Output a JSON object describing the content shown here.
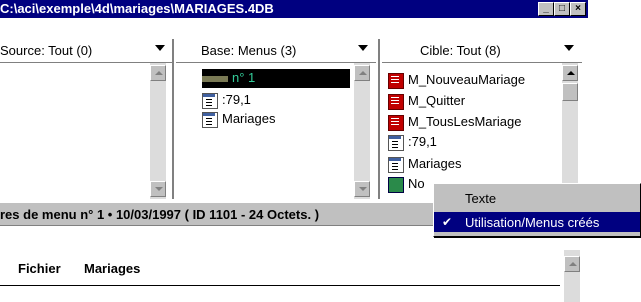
{
  "window": {
    "title": "C:\\aci\\exemple\\4d\\mariages\\MARIAGES.4DB",
    "minimize": "_",
    "maximize": "□",
    "close": "×"
  },
  "source_combo": {
    "label": "Source: Tout (0)"
  },
  "base_combo": {
    "label": "Base: Menus (3)"
  },
  "cible_combo": {
    "label": "Cible: Tout (8)"
  },
  "base_list": {
    "items": [
      {
        "label": "n° 1",
        "icon": "menu-bar-icon",
        "selected": true
      },
      {
        "label": ":79,1",
        "icon": "menu-icon"
      },
      {
        "label": "Mariages",
        "icon": "menu-icon"
      }
    ]
  },
  "cible_list": {
    "items": [
      {
        "label": "M_NouveauMariage",
        "icon": "method-icon"
      },
      {
        "label": "M_Quitter",
        "icon": "method-icon"
      },
      {
        "label": "M_TousLesMariage",
        "icon": "method-icon"
      },
      {
        "label": ":79,1",
        "icon": "menu-icon"
      },
      {
        "label": "Mariages",
        "icon": "menu-icon"
      },
      {
        "label": "No",
        "icon": "globe-icon"
      }
    ]
  },
  "status": {
    "text": "res de menu n° 1 • 10/03/1997 ( ID 1101 - 24 Octets. )"
  },
  "menubar": {
    "items": [
      "Fichier",
      "Mariages"
    ]
  },
  "popup_menu": {
    "items": [
      {
        "label": "Texte",
        "checked": false,
        "highlighted": false
      },
      {
        "label": "Utilisation/Menus créés",
        "checked": true,
        "highlighted": true
      }
    ],
    "check_glyph": "✔"
  }
}
